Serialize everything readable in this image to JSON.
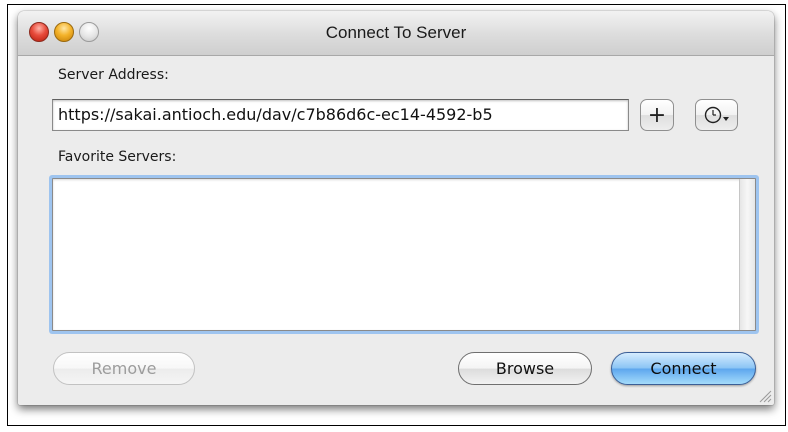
{
  "window": {
    "title": "Connect To Server"
  },
  "server_address": {
    "label": "Server Address:",
    "value": "https://sakai.antioch.edu/dav/c7b86d6c-ec14-4592-b5"
  },
  "toolbar": {
    "add_label": "+",
    "recent_icon": "clock-icon"
  },
  "favorites": {
    "label": "Favorite Servers:",
    "items": []
  },
  "buttons": {
    "remove_label": "Remove",
    "browse_label": "Browse",
    "connect_label": "Connect"
  },
  "colors": {
    "accent": "#5ea7ee",
    "focus_ring": "#9ec4ef",
    "close": "#e84c3c",
    "minimize": "#f4b32a"
  }
}
